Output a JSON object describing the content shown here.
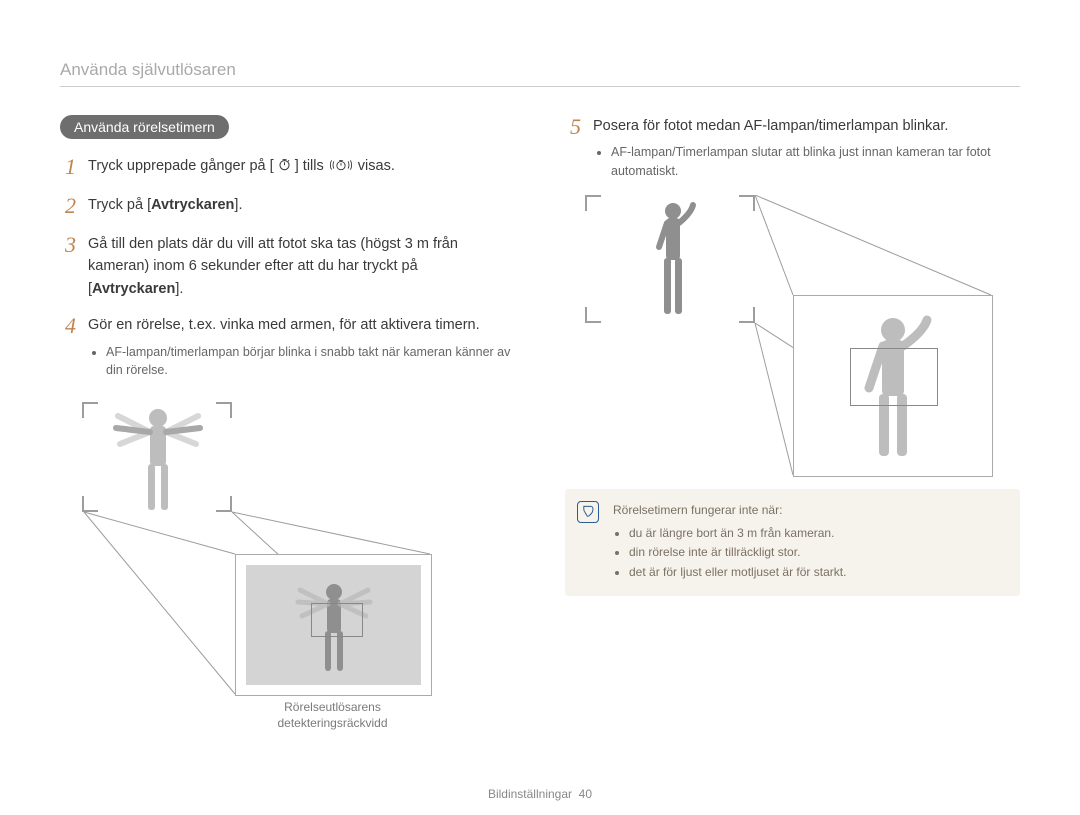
{
  "page_title": "Använda självutlösaren",
  "section_title": "Använda rörelsetimern",
  "left": {
    "steps": [
      {
        "num": "1",
        "prefix": "Tryck upprepade gånger på [",
        "mid1": "] tills ",
        "suffix": " visas."
      },
      {
        "num": "2",
        "prefix": "Tryck på [",
        "strong": "Avtryckaren",
        "suffix": "]."
      },
      {
        "num": "3",
        "prefix": "Gå till den plats där du vill att fotot ska tas (högst 3 m från kameran) inom 6 sekunder efter att du har tryckt på [",
        "strong": "Avtryckaren",
        "suffix": "]."
      },
      {
        "num": "4",
        "text": "Gör en rörelse, t.ex. vinka med armen, för att aktivera timern.",
        "bullet": "AF-lampan/timerlampan börjar blinka i snabb takt när kameran känner av din rörelse."
      }
    ],
    "diagram_caption": "Rörelseutlösarens detekteringsräckvidd"
  },
  "right": {
    "step5": {
      "num": "5",
      "text": "Posera för fotot medan AF-lampan/timerlampan blinkar.",
      "bullet": "AF-lampan/Timerlampan slutar att blinka just innan kameran tar fotot automatiskt."
    },
    "notice": {
      "title": "Rörelsetimern fungerar inte när:",
      "items": [
        "du är längre bort än 3 m från kameran.",
        "din rörelse inte är tillräckligt stor.",
        "det är för ljust eller motljuset är för starkt."
      ]
    }
  },
  "footer": {
    "label": "Bildinställningar",
    "page": "40"
  }
}
